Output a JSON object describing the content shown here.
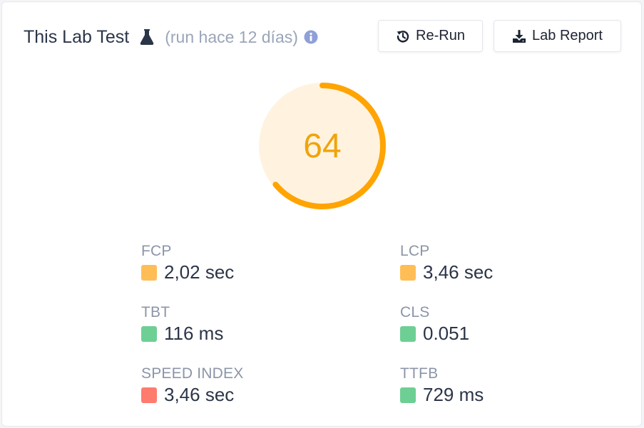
{
  "header": {
    "title": "This Lab Test",
    "run_info": "(run hace 12 días)",
    "rerun_label": "Re-Run",
    "report_label": "Lab Report"
  },
  "gauge": {
    "score": "64",
    "progress": 0.64,
    "color": "#ffa400",
    "background": "#fff3e0"
  },
  "colors": {
    "average": "#ffbe55",
    "good": "#6dcf94",
    "poor": "#ff7b6e"
  },
  "metrics": [
    {
      "label": "FCP",
      "value": "2,02 sec",
      "status": "average"
    },
    {
      "label": "LCP",
      "value": "3,46 sec",
      "status": "average"
    },
    {
      "label": "TBT",
      "value": "116 ms",
      "status": "good"
    },
    {
      "label": "CLS",
      "value": "0.051",
      "status": "good"
    },
    {
      "label": "SPEED INDEX",
      "value": "3,46 sec",
      "status": "poor"
    },
    {
      "label": "TTFB",
      "value": "729 ms",
      "status": "good"
    }
  ],
  "icons": {
    "flask": "flask-icon",
    "info": "info-icon",
    "rerun": "history-icon",
    "report": "download-icon"
  }
}
